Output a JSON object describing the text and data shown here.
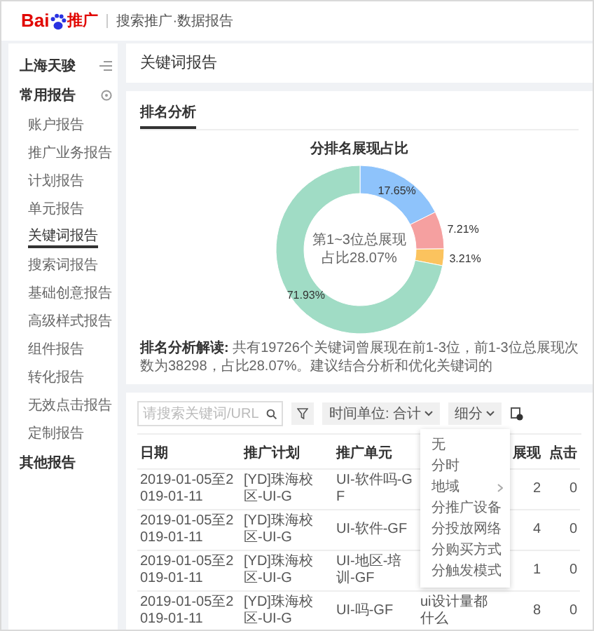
{
  "header": {
    "logo_text": "Bai",
    "logo_suffix": "推广",
    "title": "搜索推广·数据报告"
  },
  "sidebar": {
    "account": "上海天骏",
    "groups": [
      {
        "title": "常用报告",
        "expanded": true,
        "items": [
          {
            "label": "账户报告",
            "selected": false
          },
          {
            "label": "推广业务报告",
            "selected": false
          },
          {
            "label": "计划报告",
            "selected": false
          },
          {
            "label": "单元报告",
            "selected": false
          },
          {
            "label": "关键词报告",
            "selected": true
          },
          {
            "label": "搜索词报告",
            "selected": false
          },
          {
            "label": "基础创意报告",
            "selected": false
          },
          {
            "label": "高级样式报告",
            "selected": false
          },
          {
            "label": "组件报告",
            "selected": false
          },
          {
            "label": "转化报告",
            "selected": false
          },
          {
            "label": "无效点击报告",
            "selected": false
          },
          {
            "label": "定制报告",
            "selected": false
          }
        ]
      },
      {
        "title": "其他报告",
        "expanded": false
      }
    ]
  },
  "page_title": "关键词报告",
  "analysis": {
    "tabs": [
      {
        "label": "排名分析",
        "selected": true
      }
    ],
    "chart_data": {
      "type": "donut",
      "title": "分排名展现占比",
      "values": [
        17.65,
        7.21,
        3.21,
        71.93
      ],
      "colors": [
        "#8ec3fb",
        "#f5a0a0",
        "#fbc35e",
        "#a0dcc5"
      ],
      "value_labels": [
        "17.65%",
        "7.21%",
        "3.21%",
        "71.93%"
      ]
    },
    "center_text": [
      "第1~3位总展现",
      "占比28.07%"
    ],
    "summary_label": "排名分析解读:",
    "summary": "共有19726个关键词曾展现在前1-3位，前1-3位总展现次数为38298，占比28.07%。建议结合分析和优化关键词的"
  },
  "toolbar": {
    "search": {
      "placeholder": "请搜索关键词/URL"
    },
    "time_unit": "时间单位: 合计",
    "breakdown": "细分"
  },
  "menu": {
    "items": [
      {
        "label": "无",
        "submenu": false
      },
      {
        "label": "分时",
        "submenu": false
      },
      {
        "label": "地域",
        "submenu": true
      },
      {
        "label": "分推广设备",
        "submenu": false
      },
      {
        "label": "分投放网络",
        "submenu": false
      },
      {
        "label": "分购买方式",
        "submenu": false
      },
      {
        "label": "分触发模式",
        "submenu": false
      }
    ]
  },
  "table": {
    "columns": [
      "日期",
      "推广计划",
      "推广单元",
      null,
      "展现",
      "点击"
    ],
    "rows": [
      [
        "2019-01-05至2019-01-11",
        "[YD]珠海校区-UI-G",
        "UI-软件吗-GF",
        null,
        "2",
        "0"
      ],
      [
        "2019-01-05至2019-01-11",
        "[YD]珠海校区-UI-G",
        "UI-软件-GF",
        null,
        "4",
        "0"
      ],
      [
        "2019-01-05至2019-01-11",
        "[YD]珠海校区-UI-G",
        "UI-地区-培训-GF",
        null,
        "1",
        "0"
      ],
      [
        "2019-01-05至2019-01-11",
        "[YD]珠海校区-UI-G",
        "UI-吗-GF",
        "ui设计量都什么",
        "8",
        "0"
      ]
    ]
  }
}
